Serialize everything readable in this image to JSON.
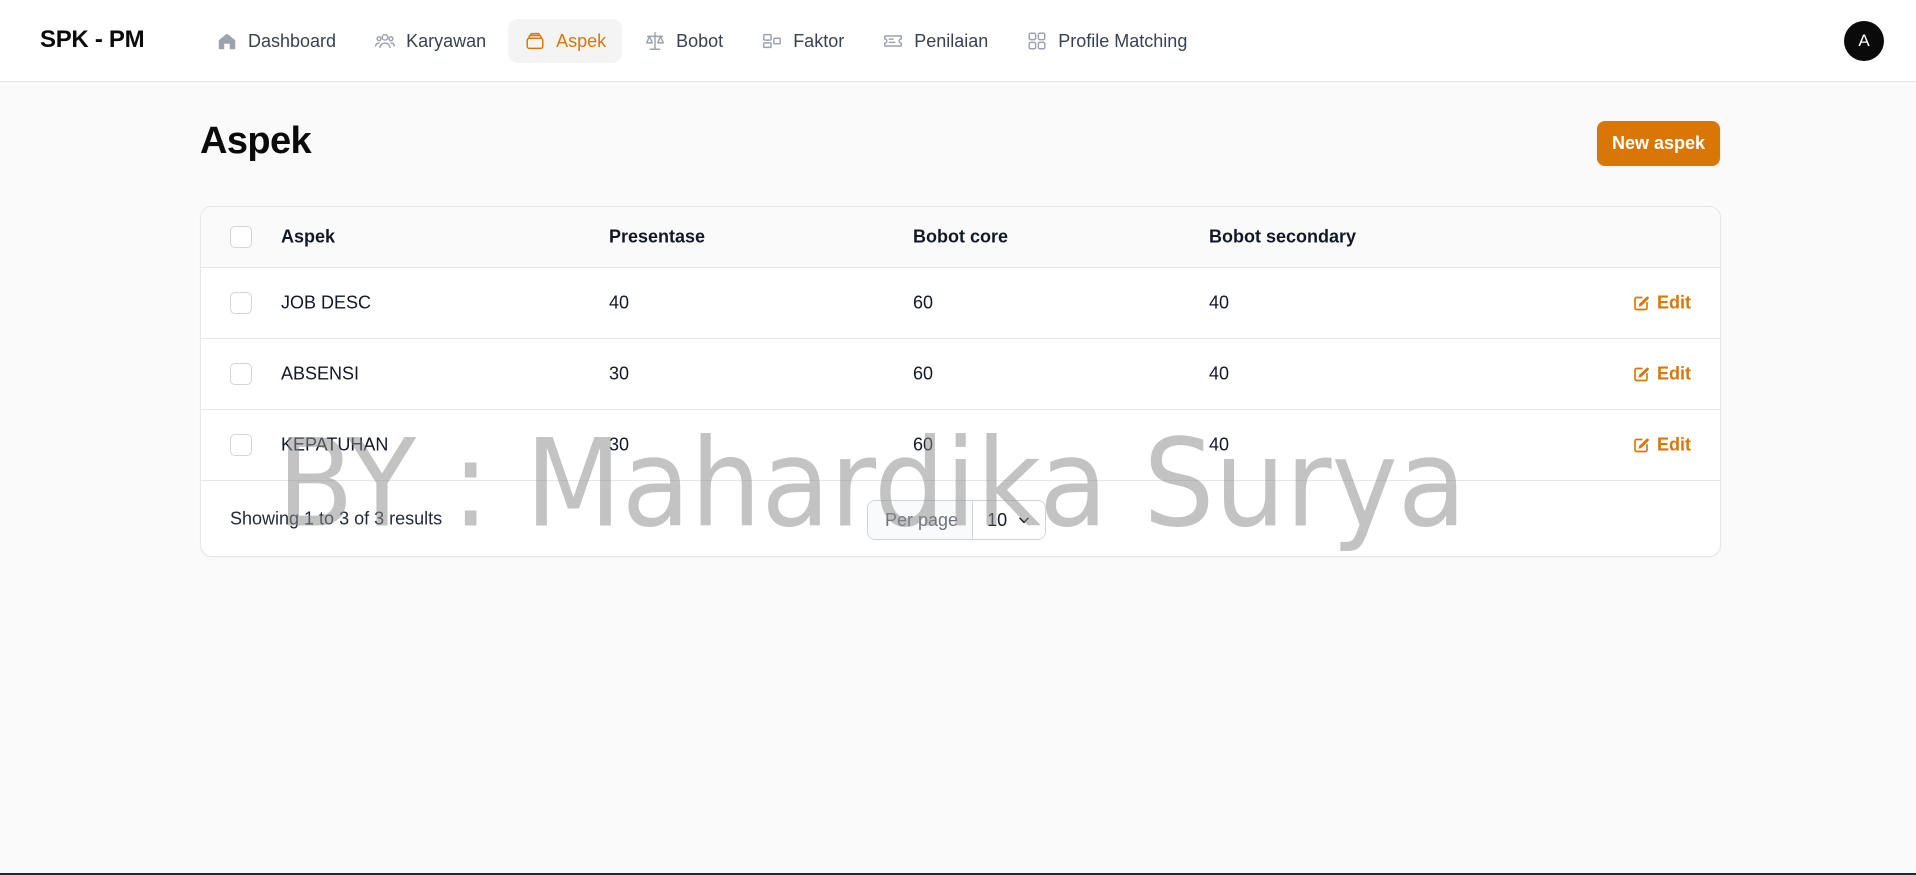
{
  "brand": "SPK - PM",
  "nav": [
    {
      "label": "Dashboard",
      "icon": "home-icon",
      "active": false
    },
    {
      "label": "Karyawan",
      "icon": "users-icon",
      "active": false
    },
    {
      "label": "Aspek",
      "icon": "stack-icon",
      "active": true
    },
    {
      "label": "Bobot",
      "icon": "scale-icon",
      "active": false
    },
    {
      "label": "Faktor",
      "icon": "layout-icon",
      "active": false
    },
    {
      "label": "Penilaian",
      "icon": "ticket-icon",
      "active": false
    },
    {
      "label": "Profile Matching",
      "icon": "grid-icon",
      "active": false
    }
  ],
  "avatar": "A",
  "page": {
    "title": "Aspek",
    "new_button": "New aspek"
  },
  "table": {
    "headers": {
      "aspek": "Aspek",
      "presentase": "Presentase",
      "bobot_core": "Bobot core",
      "bobot_secondary": "Bobot secondary"
    },
    "rows": [
      {
        "aspek": "JOB DESC",
        "presentase": "40",
        "bobot_core": "60",
        "bobot_secondary": "40",
        "action": "Edit"
      },
      {
        "aspek": "ABSENSI",
        "presentase": "30",
        "bobot_core": "60",
        "bobot_secondary": "40",
        "action": "Edit"
      },
      {
        "aspek": "KEPATUHAN",
        "presentase": "30",
        "bobot_core": "60",
        "bobot_secondary": "40",
        "action": "Edit"
      }
    ],
    "footer": {
      "showing": "Showing 1 to 3 of 3 results",
      "per_page_label": "Per page",
      "per_page_value": "10"
    }
  },
  "watermark": "BY : Mahardika Surya",
  "colors": {
    "accent": "#d97706",
    "background": "#fafafa",
    "border": "#e5e7eb",
    "avatar_bg": "#0a0a0a"
  }
}
